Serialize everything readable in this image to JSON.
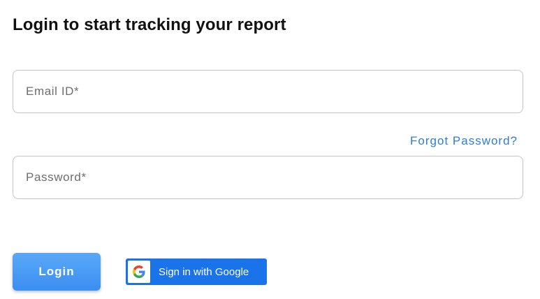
{
  "title": "Login to start tracking your report",
  "email": {
    "placeholder": "Email ID*",
    "value": ""
  },
  "forgot_password": "Forgot Password?",
  "password": {
    "placeholder": "Password*",
    "value": ""
  },
  "login_button": "Login",
  "google_button": {
    "label": "Sign in with Google",
    "icon": "google-logo"
  },
  "colors": {
    "link": "#2d7dd2",
    "login_button": "#4a9df4",
    "google_button": "#1a73e8"
  }
}
